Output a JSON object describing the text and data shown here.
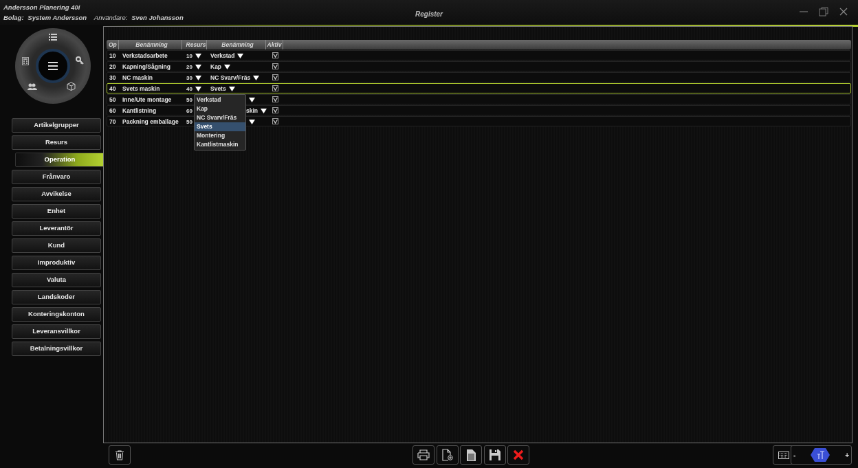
{
  "window": {
    "app_title": "Andersson Planering 40i",
    "company_label": "Bolag:",
    "company": "System Andersson",
    "user_label": "Användare:",
    "user": "Sven Johansson",
    "title": "Register"
  },
  "sidebar": {
    "items": [
      {
        "label": "Artikelgrupper",
        "selected": false
      },
      {
        "label": "Resurs",
        "selected": false
      },
      {
        "label": "Operation",
        "selected": true
      },
      {
        "label": "Frånvaro",
        "selected": false
      },
      {
        "label": "Avvikelse",
        "selected": false
      },
      {
        "label": "Enhet",
        "selected": false
      },
      {
        "label": "Leverantör",
        "selected": false
      },
      {
        "label": "Kund",
        "selected": false
      },
      {
        "label": "Improduktiv",
        "selected": false
      },
      {
        "label": "Valuta",
        "selected": false
      },
      {
        "label": "Landskoder",
        "selected": false
      },
      {
        "label": "Konteringskonton",
        "selected": false
      },
      {
        "label": "Leveransvillkor",
        "selected": false
      },
      {
        "label": "Betalningsvillkor",
        "selected": false
      }
    ]
  },
  "table": {
    "columns": [
      "Op",
      "Benämning",
      "Resurs",
      "Benämning",
      "Aktiv"
    ],
    "rows": [
      {
        "op": "10",
        "name": "Verkstadsarbete",
        "resource": "10",
        "resource_name": "Verkstad",
        "covered": false,
        "active": true,
        "selected": false
      },
      {
        "op": "20",
        "name": "Kapning/Sågning",
        "resource": "20",
        "resource_name": "Kap",
        "covered": false,
        "active": true,
        "selected": false
      },
      {
        "op": "30",
        "name": "NC maskin",
        "resource": "30",
        "resource_name": "NC Svarv/Fräs",
        "covered": false,
        "active": true,
        "selected": false
      },
      {
        "op": "40",
        "name": "Svets maskin",
        "resource": "40",
        "resource_name": "Svets",
        "covered": false,
        "active": true,
        "selected": true
      },
      {
        "op": "50",
        "name": "Inne/Ute montage",
        "resource": "50",
        "covered": true,
        "active": true,
        "selected": false
      },
      {
        "op": "60",
        "name": "Kantlistning",
        "resource": "60",
        "resource_name": "skin",
        "covered": true,
        "active": true,
        "selected": false
      },
      {
        "op": "70",
        "name": "Packning emballage",
        "resource": "50",
        "covered": true,
        "active": true,
        "selected": false
      }
    ]
  },
  "dropdown": {
    "options": [
      {
        "label": "Verkstad",
        "selected": false
      },
      {
        "label": "Kap",
        "selected": false
      },
      {
        "label": "NC Svarv/Fräs",
        "selected": false
      },
      {
        "label": "Svets",
        "selected": true
      },
      {
        "label": "Montering",
        "selected": false
      },
      {
        "label": "Kantlistmaskin",
        "selected": false
      }
    ]
  },
  "font_size_control": {
    "minus": "-",
    "plus": "+"
  }
}
